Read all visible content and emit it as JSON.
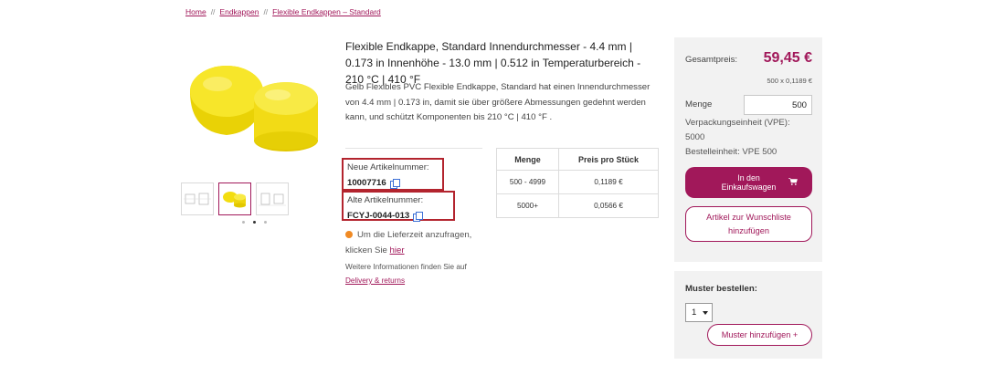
{
  "breadcrumb": {
    "items": [
      "Home",
      "Endkappen",
      "Flexible Endkappen – Standard"
    ],
    "separator": "//"
  },
  "product": {
    "title": "Flexible Endkappe, Standard Innendurchmesser - 4.4 mm | 0.173 in Innenhöhe - 13.0 mm | 0.512 in Temperaturbereich - 210 °C | 410 °F",
    "description": "Gelb Flexibles PVC Flexible Endkappe, Standard hat einen Innendurchmesser von 4.4 mm | 0.173 in, damit sie über größere Abmessungen gedehnt werden kann, und schützt Komponenten bis 210 °C | 410 °F .",
    "color": "#f5e21c"
  },
  "articles": {
    "new_label": "Neue Artikelnummer:",
    "new_number": "10007716",
    "old_label": "Alte Artikelnummer:",
    "old_number": "FCYJ-0044-013"
  },
  "delivery": {
    "text": "Um die Lieferzeit anzufragen, klicken Sie",
    "link": "hier",
    "more_info": "Weitere Informationen finden Sie auf",
    "more_link": "Delivery & returns"
  },
  "price_table": {
    "headers": [
      "Menge",
      "Preis pro Stück"
    ],
    "rows": [
      [
        "500 - 4999",
        "0,1189 €"
      ],
      [
        "5000+",
        "0,0566 €"
      ]
    ]
  },
  "side": {
    "total_label": "Gesamtpreis:",
    "total_value": "59,45 €",
    "total_sub": "500 x 0,1189 €",
    "menge_label": "Menge",
    "menge_value": "500",
    "vpe_line1": "Verpackungseinheit (VPE):",
    "vpe_line2": "5000",
    "vpe_line3": "Bestelleinheit: VPE 500",
    "cart_button": "In den Einkaufswagen",
    "wishlist_button": "Artikel zur Wunschliste hinzufügen"
  },
  "muster": {
    "title": "Muster bestellen:",
    "select_value": "1",
    "button": "Muster hinzufügen +"
  },
  "colors": {
    "accent": "#a1185a",
    "highlight_box": "#b3242e",
    "status_dot": "#f08a24"
  }
}
